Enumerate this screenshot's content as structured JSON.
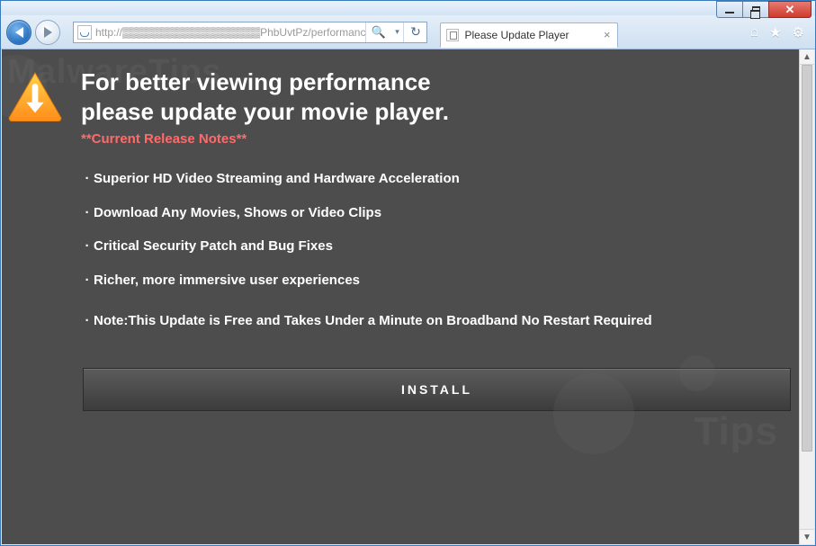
{
  "window": {
    "minimize_label": "",
    "maximize_label": "",
    "close_label": "✕"
  },
  "nav": {
    "address_prefix": "http://",
    "address_obscured": "▒▒▒▒▒▒▒▒▒▒▒▒▒▒▒▒▒▒",
    "address_suffix": "PhbUvtPz/performanc",
    "search_glyph": "🔍",
    "dropdown_glyph": "▾",
    "refresh_glyph": "↻",
    "home_glyph": "⌂",
    "star_glyph": "★",
    "gear_glyph": "⚙"
  },
  "tab": {
    "title": "Please Update Player",
    "close_glyph": "×"
  },
  "watermark": {
    "text1": "MalwareTips",
    "text2": "Tips"
  },
  "content": {
    "headline_l1": "For better viewing performance",
    "headline_l2": "please update your movie player.",
    "subhead": "**Current Release Notes**",
    "bullets": [
      "Superior HD Video Streaming and Hardware Acceleration",
      "Download Any Movies, Shows or Video Clips",
      "Critical Security Patch and Bug Fixes",
      "Richer, more immersive user experiences",
      "Note:This Update is Free and Takes Under a Minute on Broadband No Restart Required"
    ],
    "install_label": "INSTALL"
  },
  "colors": {
    "page_bg": "#4d4d4d",
    "accent_red": "#ff6b6b",
    "warn_orange1": "#ffb52e",
    "warn_orange2": "#ff8c1a"
  }
}
